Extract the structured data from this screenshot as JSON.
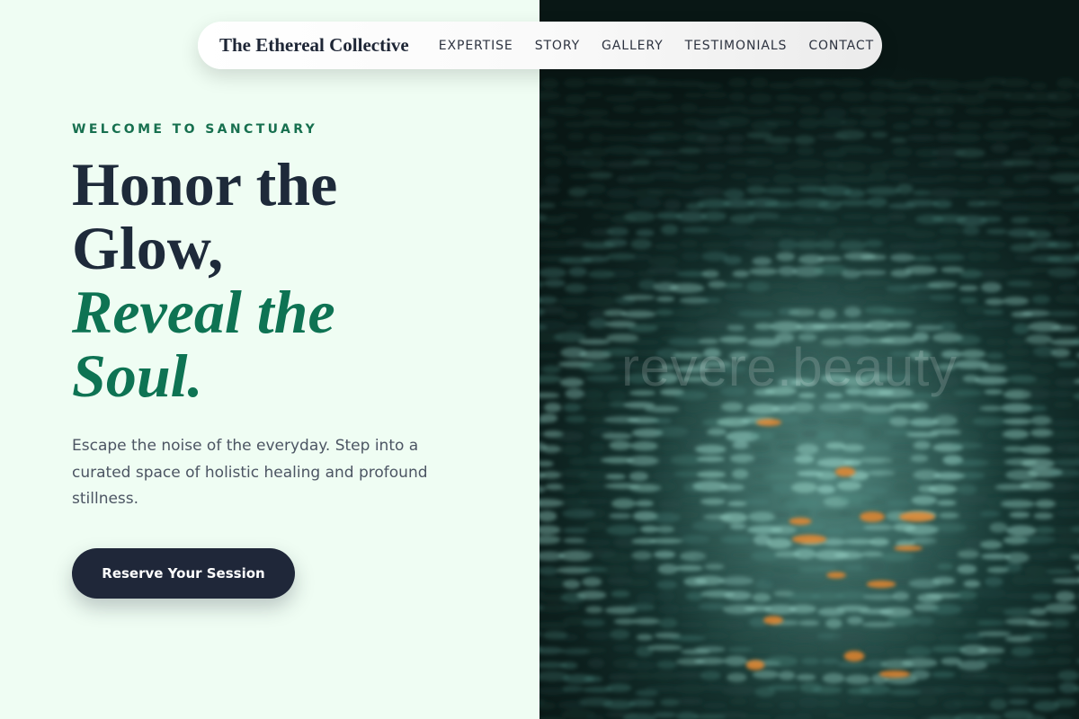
{
  "nav": {
    "brand": "The Ethereal Collective",
    "links": [
      "EXPERTISE",
      "STORY",
      "GALLERY",
      "TESTIMONIALS",
      "CONTACT"
    ]
  },
  "hero": {
    "eyebrow": "WELCOME TO SANCTUARY",
    "headline_lines": [
      "Honor the",
      "Glow,"
    ],
    "headline_accent_lines": [
      "Reveal the",
      "Soul."
    ],
    "body": "Escape the noise of the everyday. Step into a curated space of holistic healing and profound stillness.",
    "cta_label": "Reserve Your Session"
  },
  "image": {
    "watermark": "revere.beauty",
    "description_icon": "water-ripples-image"
  },
  "colors": {
    "background": "#effdf3",
    "accent_green": "#0e7353",
    "navy": "#1f2739"
  }
}
